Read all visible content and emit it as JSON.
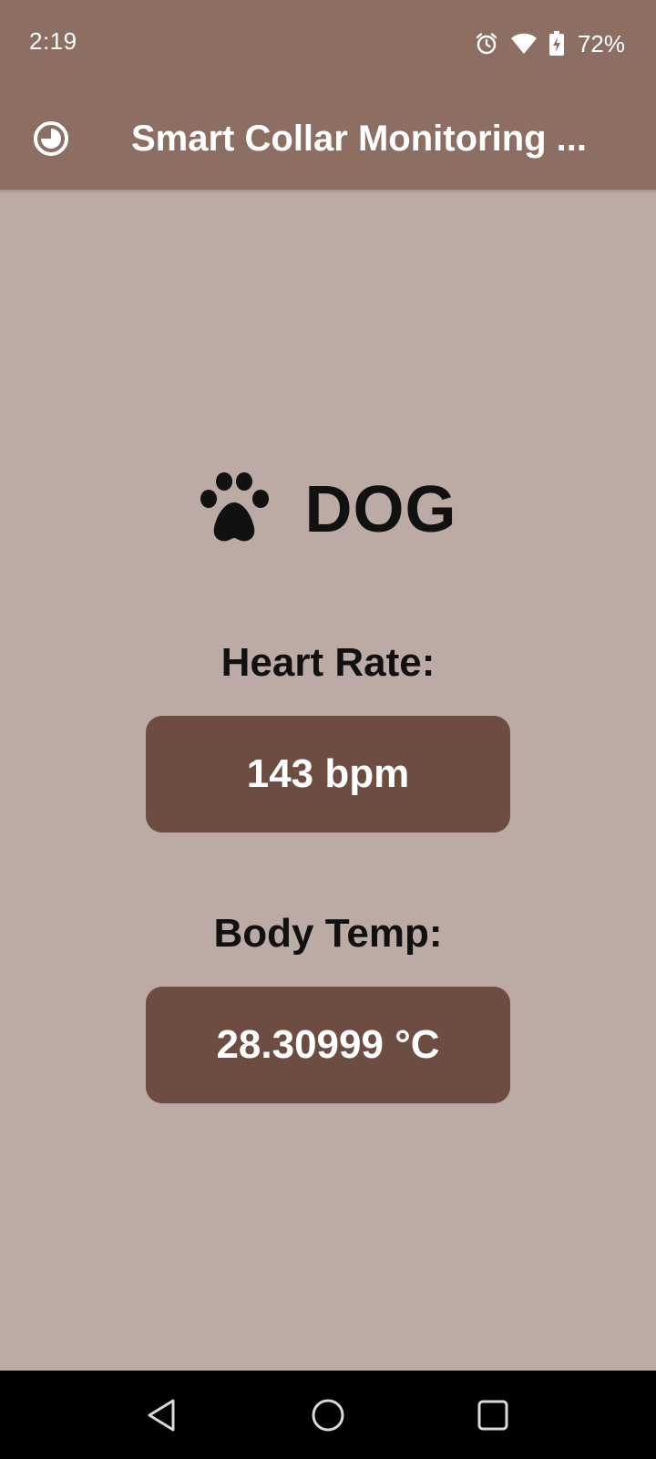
{
  "status_bar": {
    "time": "2:19",
    "battery_percent": "72%",
    "icons": [
      "alarm-icon",
      "wifi-icon",
      "battery-charging-icon"
    ]
  },
  "app_bar": {
    "title": "Smart Collar Monitoring ...",
    "icon": "theme-toggle-icon"
  },
  "pet": {
    "icon": "paw-icon",
    "name": "DOG"
  },
  "metrics": {
    "heart_rate": {
      "label": "Heart Rate:",
      "value": "143 bpm"
    },
    "body_temp": {
      "label": "Body Temp:",
      "value": "28.30999 °C"
    }
  },
  "nav_bar": {
    "buttons": [
      "back-icon",
      "home-icon",
      "recents-icon"
    ]
  },
  "colors": {
    "app_bar": "#8d6e63",
    "background": "#bcaaa4",
    "metric_box": "#6d4c41",
    "text_dark": "#111111",
    "nav_bar": "#000000"
  }
}
